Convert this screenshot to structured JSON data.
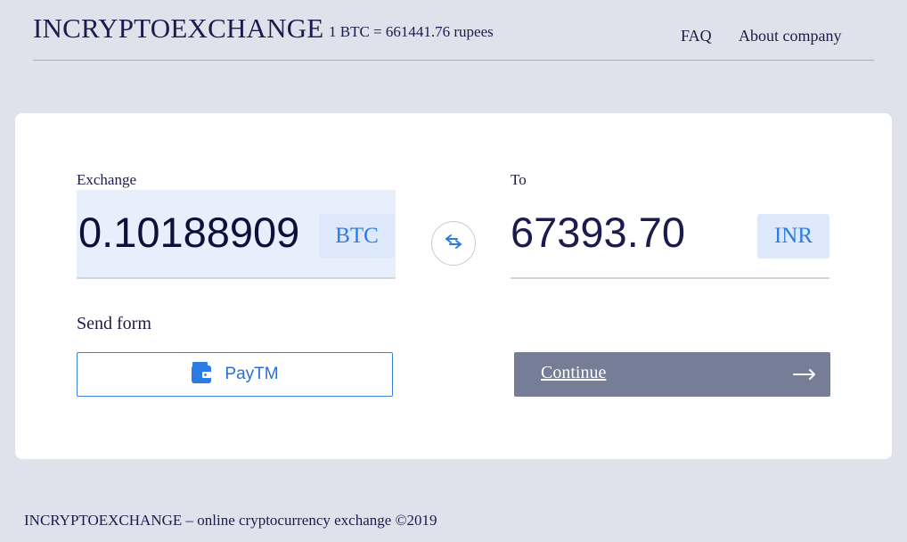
{
  "header": {
    "brand": "INCRYPTOEXCHANGE",
    "rate": "1 BTC = 661441.76 rupees",
    "nav": {
      "faq": "FAQ",
      "about": "About company"
    }
  },
  "exchange": {
    "from_label": "Exchange",
    "from_amount": "0.10188909",
    "from_currency": "BTC",
    "to_label": "To",
    "to_amount": "67393.70",
    "to_currency": "INR",
    "swap_icon": "swap-arrows-icon"
  },
  "send_form": {
    "label": "Send form",
    "method": "PayTM",
    "method_icon": "wallet-icon"
  },
  "continue": {
    "label": "Continue",
    "icon": "long-arrow-right-icon"
  },
  "footer": {
    "text": "INCRYPTOEXCHANGE – online cryptocurrency exchange ©2019"
  },
  "colors": {
    "background": "#dfe2ea",
    "card": "#ffffff",
    "text": "#1c1b4d",
    "accent": "#2b7be5",
    "from_highlight": "#e8effc",
    "currency_badge": "#dde9fb",
    "continue_button": "#767d96"
  }
}
